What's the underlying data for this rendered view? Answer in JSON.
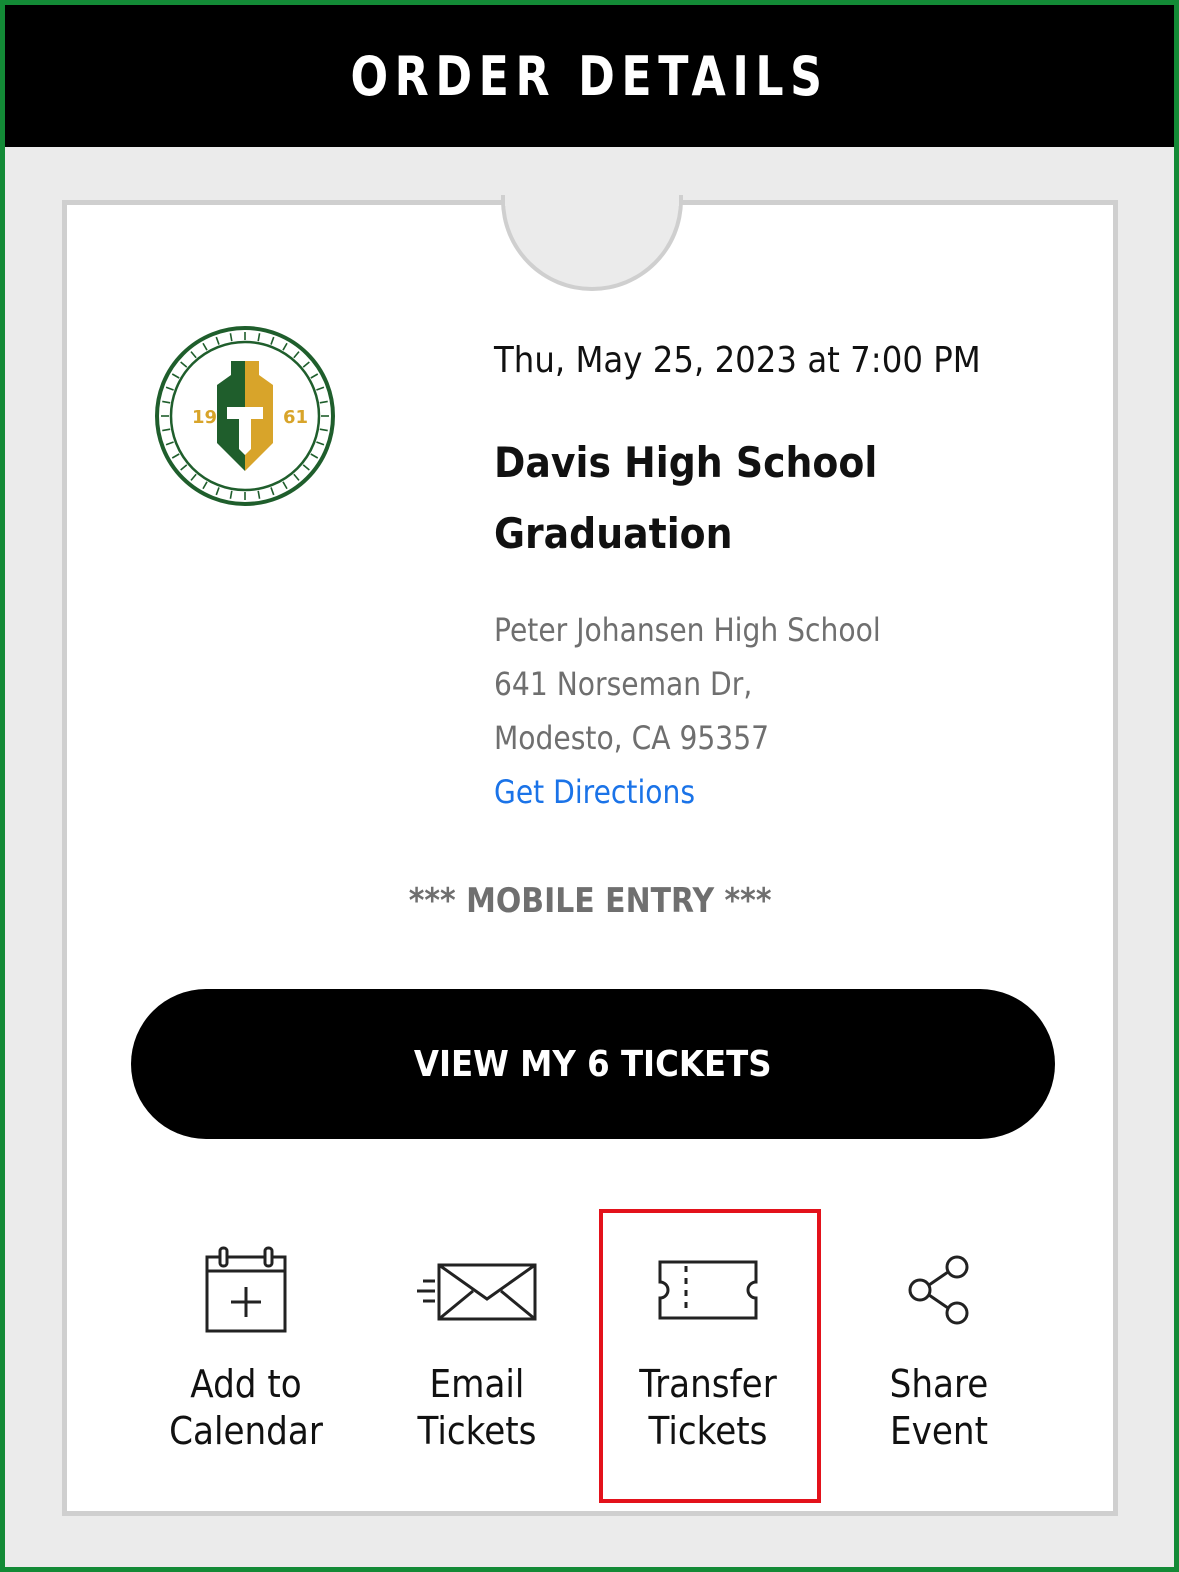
{
  "header": {
    "title": "ORDER DETAILS"
  },
  "event": {
    "datetime": "Thu, May 25, 2023 at 7:00 PM",
    "title": "Davis High School Graduation",
    "venue": "Peter Johansen High School",
    "address_line1": "641 Norseman Dr,",
    "address_line2": "Modesto, CA 95357",
    "directions_link": "Get Directions",
    "entry_type": "*** MOBILE ENTRY ***",
    "logo": {
      "left": "19",
      "right": "61"
    }
  },
  "primary_action": {
    "label": "VIEW MY 6 TICKETS"
  },
  "actions": [
    {
      "label": "Add to\nCalendar",
      "icon": "calendar-add-icon"
    },
    {
      "label": "Email\nTickets",
      "icon": "email-icon"
    },
    {
      "label": "Transfer\nTickets",
      "icon": "ticket-icon"
    },
    {
      "label": "Share\nEvent",
      "icon": "share-icon"
    }
  ],
  "colors": {
    "frame": "#138a36",
    "logo_green": "#1f5e2c",
    "logo_gold": "#d8a42a",
    "link": "#1a73e8",
    "highlight": "#e3121b"
  }
}
